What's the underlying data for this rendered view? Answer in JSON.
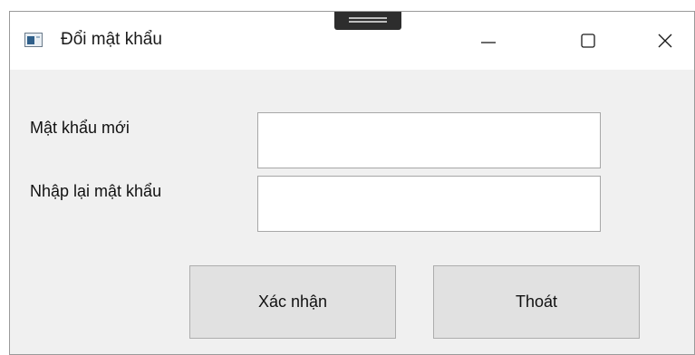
{
  "window": {
    "title": "Đổi mật khẩu",
    "icon": "app-window-icon"
  },
  "caption_buttons": {
    "minimize_icon": "minimize-icon",
    "maximize_icon": "maximize-icon",
    "close_icon": "close-icon"
  },
  "form": {
    "new_password_label": "Mật khẩu mới",
    "new_password_value": "",
    "confirm_password_label": "Nhập lại mật khẩu",
    "confirm_password_value": ""
  },
  "buttons": {
    "confirm_label": "Xác nhận",
    "exit_label": "Thoát"
  }
}
